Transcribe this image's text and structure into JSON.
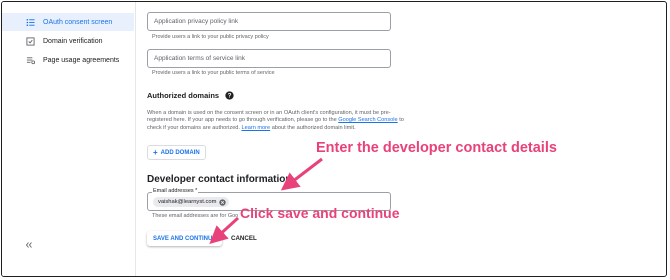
{
  "sidebar": {
    "items": [
      {
        "label": "OAuth consent screen",
        "icon": "consent-list-icon",
        "active": true
      },
      {
        "label": "Domain verification",
        "icon": "verification-icon",
        "active": false
      },
      {
        "label": "Page usage agreements",
        "icon": "agreements-icon",
        "active": false
      }
    ],
    "collapse_icon": "collapse-chevron-icon"
  },
  "form": {
    "privacy_field": {
      "placeholder": "Application privacy policy link",
      "helper": "Provide users a link to your public privacy policy"
    },
    "terms_field": {
      "placeholder": "Application terms of service link",
      "helper": "Provide users a link to your public terms of service"
    },
    "authorized_domains": {
      "title": "Authorized domains",
      "text_1": "When a domain is used on the consent screen or in an OAuth client's configuration, it must be pre-registered here. If your app needs to go through verification, please go to the ",
      "link_search_console": "Google Search Console",
      "text_2": " to check if your domains are authorized. ",
      "link_learn_more": "Learn more",
      "text_3": " about the authorized domain limit.",
      "add_button": "ADD DOMAIN"
    },
    "developer_contact": {
      "title": "Developer contact information",
      "email_label": "Email addresses *",
      "email_chip": "vaishak@learnyst.com",
      "helper": "These email addresses are for Goo"
    },
    "save_button": "SAVE AND CONTINUE",
    "cancel_button": "CANCEL"
  },
  "annotations": {
    "contact_note": "Enter the developer contact details",
    "save_note": "Click save and continue",
    "color": "#e8427a"
  },
  "colors": {
    "accent": "#1a73e8",
    "active_bg": "#e8f0fe"
  }
}
